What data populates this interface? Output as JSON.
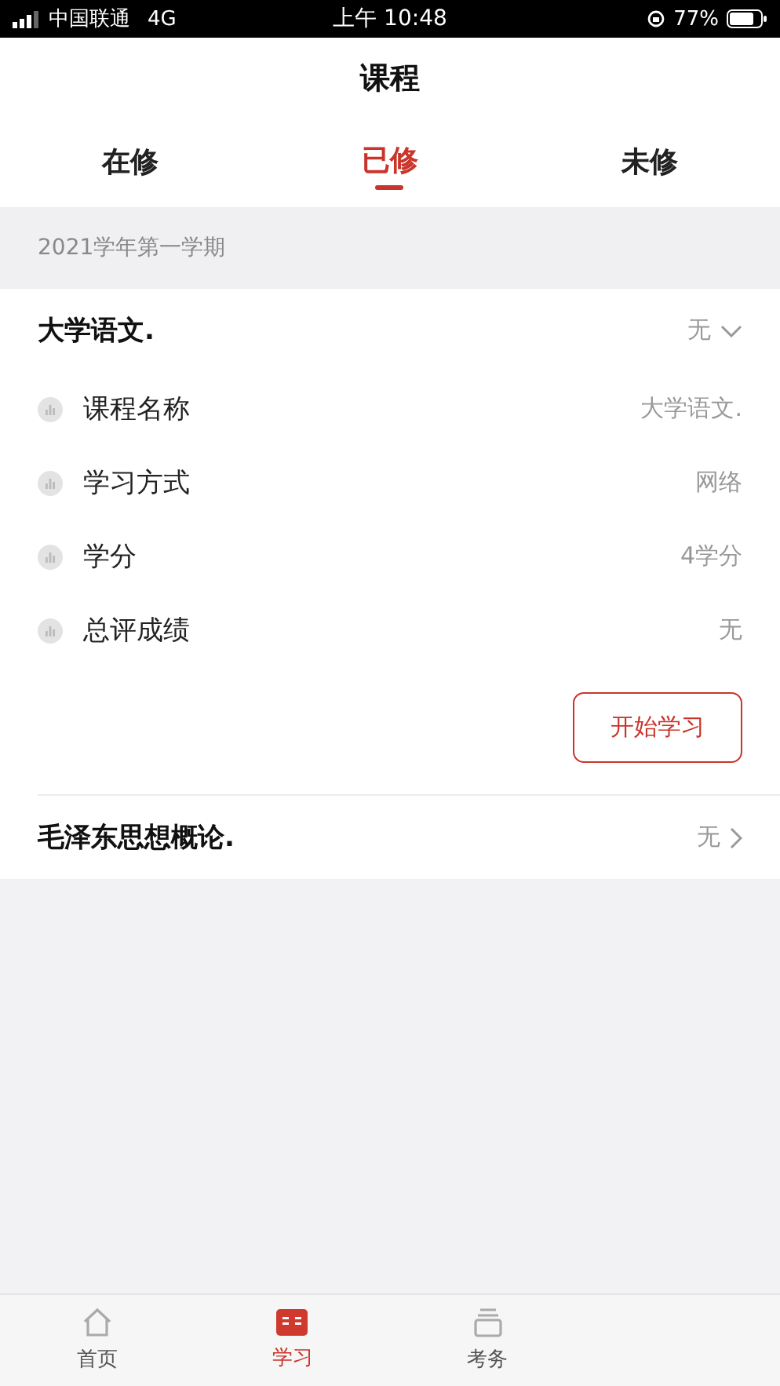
{
  "status_bar": {
    "carrier": "中国联通",
    "network": "4G",
    "time": "上午 10:48",
    "battery": "77%"
  },
  "header": {
    "title": "课程"
  },
  "tabs": [
    {
      "label": "在修",
      "selected": false
    },
    {
      "label": "已修",
      "selected": true
    },
    {
      "label": "未修",
      "selected": false
    }
  ],
  "semester": "2021学年第一学期",
  "courses": [
    {
      "name": "大学语文.",
      "grade": "无",
      "expanded": true,
      "details": [
        {
          "label": "课程名称",
          "value": "大学语文."
        },
        {
          "label": "学习方式",
          "value": "网络"
        },
        {
          "label": "学分",
          "value": "4学分"
        },
        {
          "label": "总评成绩",
          "value": "无"
        }
      ],
      "action": "开始学习"
    },
    {
      "name": "毛泽东思想概论.",
      "grade": "无",
      "expanded": false
    }
  ],
  "bottom_nav": [
    {
      "label": "首页",
      "kind": "home",
      "selected": false
    },
    {
      "label": "学习",
      "kind": "study",
      "selected": true
    },
    {
      "label": "考务",
      "kind": "exam",
      "selected": false
    }
  ]
}
